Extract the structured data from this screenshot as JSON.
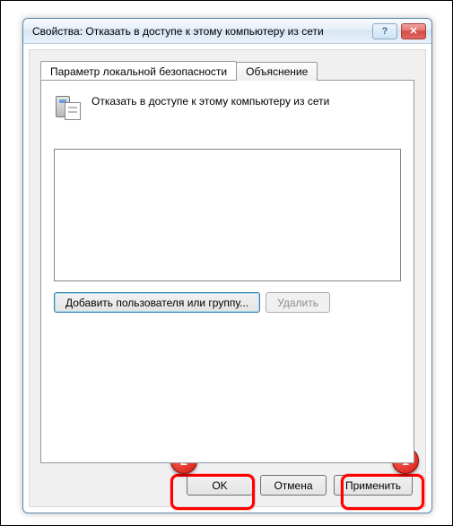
{
  "window": {
    "title": "Свойства: Отказать в доступе к этому компьютеру из сети",
    "help_symbol": "?",
    "close_symbol": "✕"
  },
  "tabs": {
    "local_security": "Параметр локальной безопасности",
    "explanation": "Объяснение"
  },
  "policy": {
    "heading": "Отказать в доступе к этому компьютеру из сети"
  },
  "buttons": {
    "add_user_group": "Добавить пользователя или группу...",
    "delete": "Удалить",
    "ok": "OK",
    "cancel": "Отмена",
    "apply": "Применить"
  },
  "annotations": {
    "step1": "1",
    "step2": "2"
  }
}
